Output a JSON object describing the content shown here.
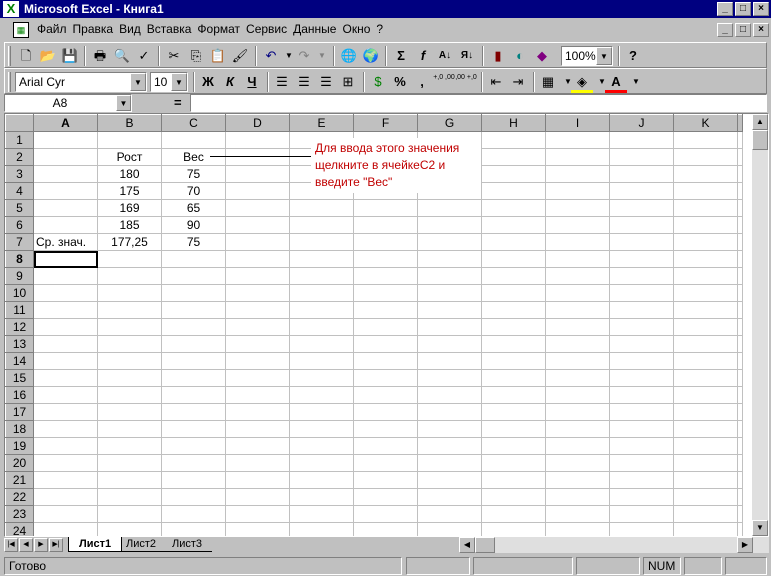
{
  "window": {
    "title": "Microsoft Excel - Книга1",
    "buttons": {
      "minimize": "_",
      "maximize": "□",
      "close": "×"
    }
  },
  "menu": {
    "items": [
      "Файл",
      "Правка",
      "Вид",
      "Вставка",
      "Формат",
      "Сервис",
      "Данные",
      "Окно",
      "?"
    ]
  },
  "toolbar1": {
    "zoom": "100%"
  },
  "toolbar2": {
    "font": "Arial Cyr",
    "size": "10",
    "bold": "Ж",
    "italic": "К",
    "underline": "Ч",
    "percent": "%",
    "comma": ",",
    "inc_decimal": "+,0 ,00",
    "dec_decimal": ",00 +,0"
  },
  "formula_bar": {
    "name_box": "A8",
    "equals": "=",
    "value": ""
  },
  "sheet": {
    "columns": [
      "A",
      "B",
      "C",
      "D",
      "E",
      "F",
      "G",
      "H",
      "I",
      "J",
      "K"
    ],
    "active_cell": "A8",
    "rows": [
      {
        "n": "1",
        "cells": [
          "",
          "",
          ""
        ]
      },
      {
        "n": "2",
        "cells": [
          "",
          "Рост",
          "Вес"
        ]
      },
      {
        "n": "3",
        "cells": [
          "",
          "180",
          "75"
        ]
      },
      {
        "n": "4",
        "cells": [
          "",
          "175",
          "70"
        ]
      },
      {
        "n": "5",
        "cells": [
          "",
          "169",
          "65"
        ]
      },
      {
        "n": "6",
        "cells": [
          "",
          "185",
          "90"
        ]
      },
      {
        "n": "7",
        "cells": [
          "Ср. знач.",
          "177,25",
          "75"
        ]
      },
      {
        "n": "8",
        "cells": [
          "",
          "",
          ""
        ]
      },
      {
        "n": "9",
        "cells": [
          "",
          "",
          ""
        ]
      },
      {
        "n": "10",
        "cells": [
          "",
          "",
          ""
        ]
      },
      {
        "n": "11",
        "cells": [
          "",
          "",
          ""
        ]
      },
      {
        "n": "12",
        "cells": [
          "",
          "",
          ""
        ]
      },
      {
        "n": "13",
        "cells": [
          "",
          "",
          ""
        ]
      },
      {
        "n": "14",
        "cells": [
          "",
          "",
          ""
        ]
      },
      {
        "n": "15",
        "cells": [
          "",
          "",
          ""
        ]
      },
      {
        "n": "16",
        "cells": [
          "",
          "",
          ""
        ]
      },
      {
        "n": "17",
        "cells": [
          "",
          "",
          ""
        ]
      },
      {
        "n": "18",
        "cells": [
          "",
          "",
          ""
        ]
      },
      {
        "n": "19",
        "cells": [
          "",
          "",
          ""
        ]
      },
      {
        "n": "20",
        "cells": [
          "",
          "",
          ""
        ]
      },
      {
        "n": "21",
        "cells": [
          "",
          "",
          ""
        ]
      },
      {
        "n": "22",
        "cells": [
          "",
          "",
          ""
        ]
      },
      {
        "n": "23",
        "cells": [
          "",
          "",
          ""
        ]
      },
      {
        "n": "24",
        "cells": [
          "",
          "",
          ""
        ]
      }
    ]
  },
  "comment": {
    "text_line1": "Для ввода этого значения",
    "text_line2": "щелкните в ячейкеC2 и",
    "text_line3": "введите \"Вес\"",
    "color": "#c00000"
  },
  "tabs": {
    "items": [
      "Лист1",
      "Лист2",
      "Лист3"
    ],
    "active": "Лист1"
  },
  "status": {
    "text": "Готово",
    "num": "NUM"
  },
  "colors": {
    "titlebar": "#000080",
    "face": "#c0c0c0"
  }
}
